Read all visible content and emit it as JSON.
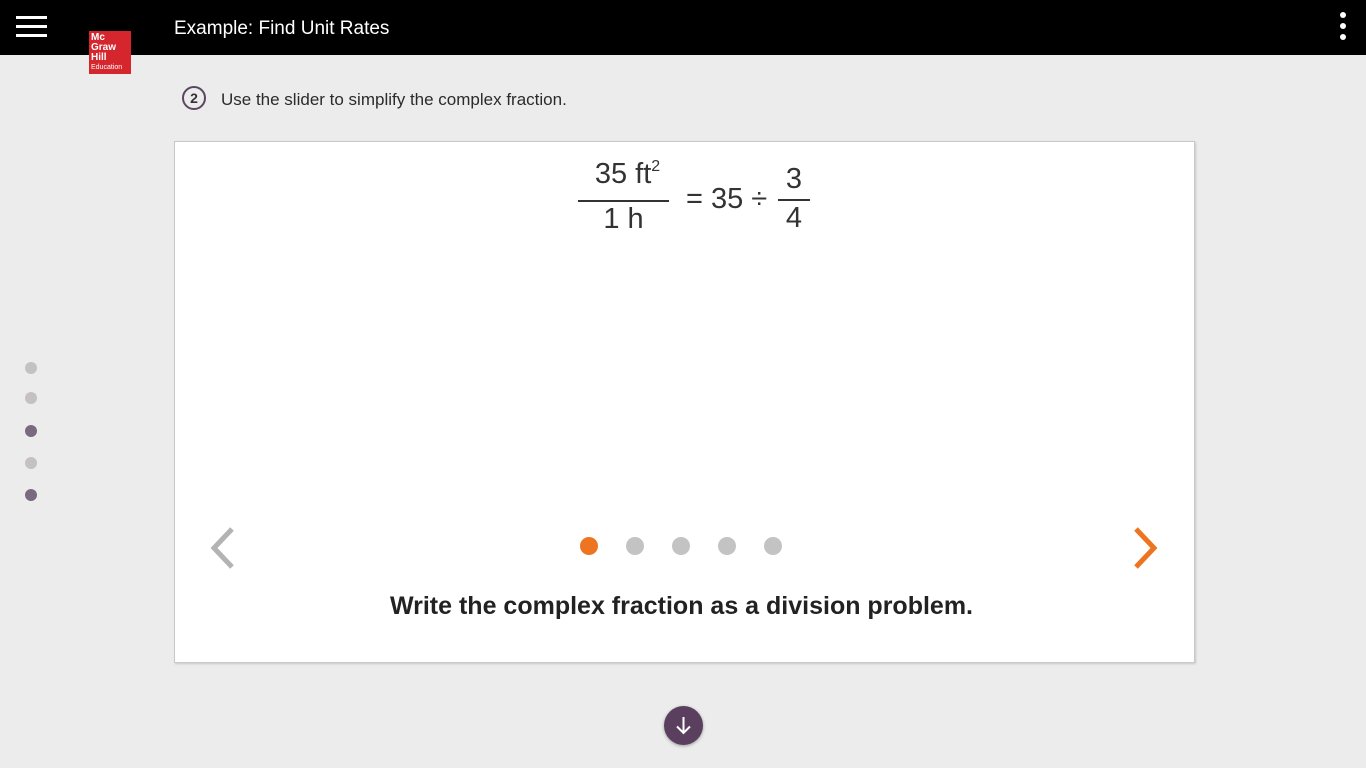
{
  "header": {
    "title": "Example: Find Unit Rates",
    "menu_icon": "hamburger-menu-icon",
    "more_icon": "more-vertical-icon"
  },
  "logo": {
    "line1": "Mc",
    "line2": "Graw",
    "line3": "Hill",
    "line4": "Education"
  },
  "step": {
    "number": "2",
    "instruction": "Use the slider to simplify the complex fraction."
  },
  "side_nav": {
    "dots": 5,
    "active_indices": [
      2,
      4
    ]
  },
  "slide": {
    "fraction_left_numerator": "35 ft",
    "fraction_left_numerator_exponent": "2",
    "fraction_left_denominator": "1 h",
    "middle_expression": "= 35 ÷",
    "fraction_right_numerator": "3",
    "fraction_right_denominator": "4",
    "caption": "Write the complex fraction as a division problem.",
    "pager_total": 5,
    "pager_current": 1
  },
  "colors": {
    "accent": "#ed7522",
    "brand_red": "#d6262d",
    "purple": "#5a3f5e",
    "background": "#ebeceb"
  },
  "icons": {
    "prev": "chevron-left-icon",
    "next": "chevron-right-icon",
    "down": "arrow-down-icon"
  }
}
